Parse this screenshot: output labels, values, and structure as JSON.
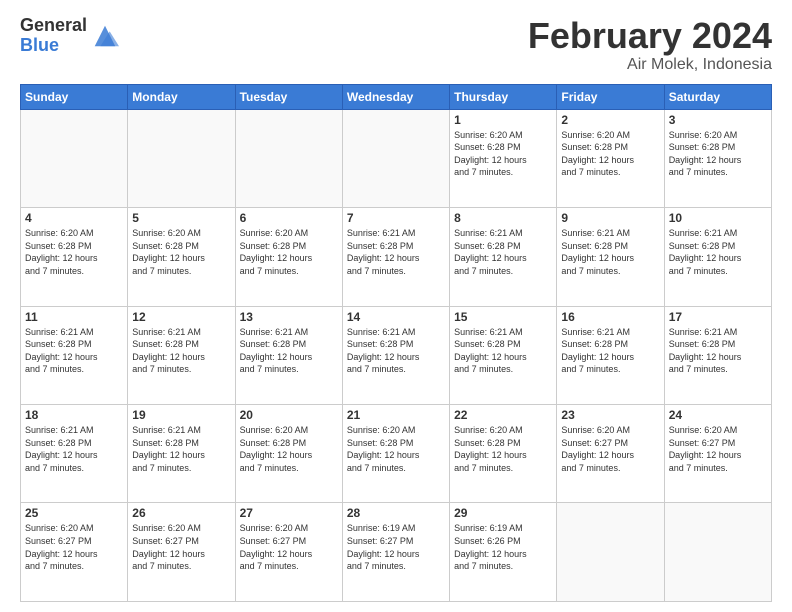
{
  "header": {
    "logo": {
      "general": "General",
      "blue": "Blue"
    },
    "title": "February 2024",
    "location": "Air Molek, Indonesia"
  },
  "days_of_week": [
    "Sunday",
    "Monday",
    "Tuesday",
    "Wednesday",
    "Thursday",
    "Friday",
    "Saturday"
  ],
  "weeks": [
    [
      {
        "day": "",
        "info": ""
      },
      {
        "day": "",
        "info": ""
      },
      {
        "day": "",
        "info": ""
      },
      {
        "day": "",
        "info": ""
      },
      {
        "day": "1",
        "info": "Sunrise: 6:20 AM\nSunset: 6:28 PM\nDaylight: 12 hours\nand 7 minutes."
      },
      {
        "day": "2",
        "info": "Sunrise: 6:20 AM\nSunset: 6:28 PM\nDaylight: 12 hours\nand 7 minutes."
      },
      {
        "day": "3",
        "info": "Sunrise: 6:20 AM\nSunset: 6:28 PM\nDaylight: 12 hours\nand 7 minutes."
      }
    ],
    [
      {
        "day": "4",
        "info": "Sunrise: 6:20 AM\nSunset: 6:28 PM\nDaylight: 12 hours\nand 7 minutes."
      },
      {
        "day": "5",
        "info": "Sunrise: 6:20 AM\nSunset: 6:28 PM\nDaylight: 12 hours\nand 7 minutes."
      },
      {
        "day": "6",
        "info": "Sunrise: 6:20 AM\nSunset: 6:28 PM\nDaylight: 12 hours\nand 7 minutes."
      },
      {
        "day": "7",
        "info": "Sunrise: 6:21 AM\nSunset: 6:28 PM\nDaylight: 12 hours\nand 7 minutes."
      },
      {
        "day": "8",
        "info": "Sunrise: 6:21 AM\nSunset: 6:28 PM\nDaylight: 12 hours\nand 7 minutes."
      },
      {
        "day": "9",
        "info": "Sunrise: 6:21 AM\nSunset: 6:28 PM\nDaylight: 12 hours\nand 7 minutes."
      },
      {
        "day": "10",
        "info": "Sunrise: 6:21 AM\nSunset: 6:28 PM\nDaylight: 12 hours\nand 7 minutes."
      }
    ],
    [
      {
        "day": "11",
        "info": "Sunrise: 6:21 AM\nSunset: 6:28 PM\nDaylight: 12 hours\nand 7 minutes."
      },
      {
        "day": "12",
        "info": "Sunrise: 6:21 AM\nSunset: 6:28 PM\nDaylight: 12 hours\nand 7 minutes."
      },
      {
        "day": "13",
        "info": "Sunrise: 6:21 AM\nSunset: 6:28 PM\nDaylight: 12 hours\nand 7 minutes."
      },
      {
        "day": "14",
        "info": "Sunrise: 6:21 AM\nSunset: 6:28 PM\nDaylight: 12 hours\nand 7 minutes."
      },
      {
        "day": "15",
        "info": "Sunrise: 6:21 AM\nSunset: 6:28 PM\nDaylight: 12 hours\nand 7 minutes."
      },
      {
        "day": "16",
        "info": "Sunrise: 6:21 AM\nSunset: 6:28 PM\nDaylight: 12 hours\nand 7 minutes."
      },
      {
        "day": "17",
        "info": "Sunrise: 6:21 AM\nSunset: 6:28 PM\nDaylight: 12 hours\nand 7 minutes."
      }
    ],
    [
      {
        "day": "18",
        "info": "Sunrise: 6:21 AM\nSunset: 6:28 PM\nDaylight: 12 hours\nand 7 minutes."
      },
      {
        "day": "19",
        "info": "Sunrise: 6:21 AM\nSunset: 6:28 PM\nDaylight: 12 hours\nand 7 minutes."
      },
      {
        "day": "20",
        "info": "Sunrise: 6:20 AM\nSunset: 6:28 PM\nDaylight: 12 hours\nand 7 minutes."
      },
      {
        "day": "21",
        "info": "Sunrise: 6:20 AM\nSunset: 6:28 PM\nDaylight: 12 hours\nand 7 minutes."
      },
      {
        "day": "22",
        "info": "Sunrise: 6:20 AM\nSunset: 6:28 PM\nDaylight: 12 hours\nand 7 minutes."
      },
      {
        "day": "23",
        "info": "Sunrise: 6:20 AM\nSunset: 6:27 PM\nDaylight: 12 hours\nand 7 minutes."
      },
      {
        "day": "24",
        "info": "Sunrise: 6:20 AM\nSunset: 6:27 PM\nDaylight: 12 hours\nand 7 minutes."
      }
    ],
    [
      {
        "day": "25",
        "info": "Sunrise: 6:20 AM\nSunset: 6:27 PM\nDaylight: 12 hours\nand 7 minutes."
      },
      {
        "day": "26",
        "info": "Sunrise: 6:20 AM\nSunset: 6:27 PM\nDaylight: 12 hours\nand 7 minutes."
      },
      {
        "day": "27",
        "info": "Sunrise: 6:20 AM\nSunset: 6:27 PM\nDaylight: 12 hours\nand 7 minutes."
      },
      {
        "day": "28",
        "info": "Sunrise: 6:19 AM\nSunset: 6:27 PM\nDaylight: 12 hours\nand 7 minutes."
      },
      {
        "day": "29",
        "info": "Sunrise: 6:19 AM\nSunset: 6:26 PM\nDaylight: 12 hours\nand 7 minutes."
      },
      {
        "day": "",
        "info": ""
      },
      {
        "day": "",
        "info": ""
      }
    ]
  ]
}
